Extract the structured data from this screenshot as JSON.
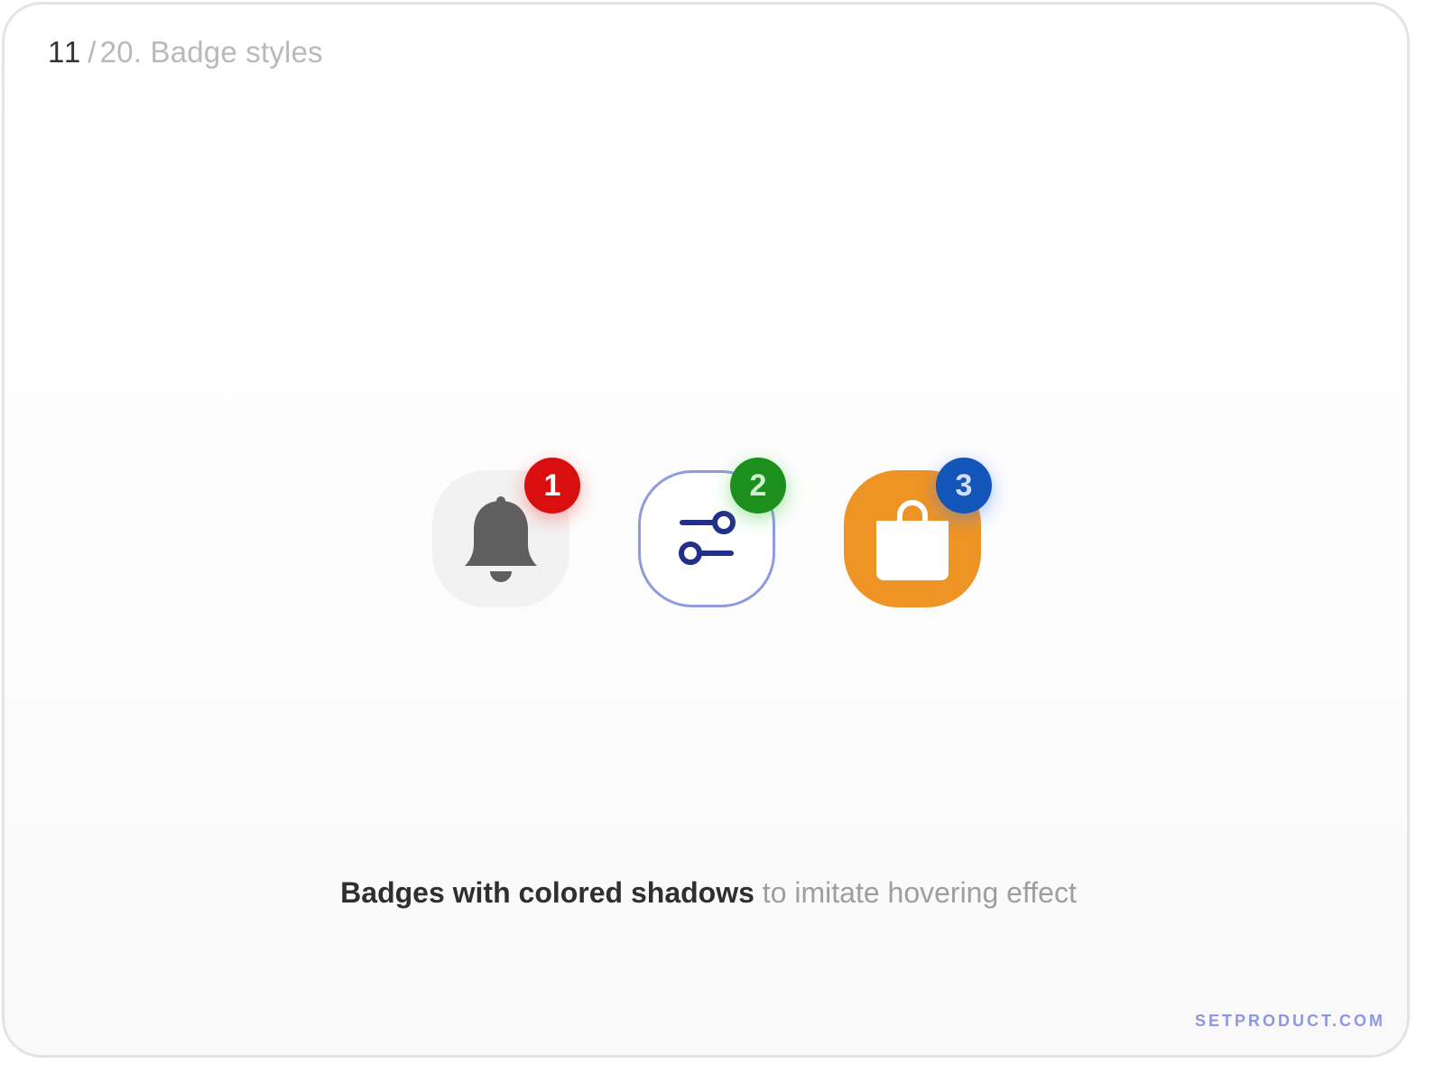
{
  "header": {
    "current": "11",
    "separator": "/",
    "total_and_title": "20. Badge styles"
  },
  "icons": [
    {
      "name": "bell-icon",
      "tile_style": "filled-light",
      "tile_color": "#f2f2f2",
      "glyph_color": "#5f5f5f"
    },
    {
      "name": "settings-sliders-icon",
      "tile_style": "outlined",
      "tile_color": "#ffffff",
      "border_color": "#8f9be0",
      "glyph_color": "#23308a"
    },
    {
      "name": "shopping-bag-icon",
      "tile_style": "filled-accent",
      "tile_color": "#ee9424",
      "glyph_color": "#ffffff"
    }
  ],
  "badges": [
    {
      "value": "1",
      "color": "#d90f0f",
      "text_color": "#ffffff"
    },
    {
      "value": "2",
      "color": "#1c8f1c",
      "text_color": "#cdf0cd"
    },
    {
      "value": "3",
      "color": "#1355b8",
      "text_color": "#cfe0ff"
    }
  ],
  "caption": {
    "strong": "Badges with colored shadows",
    "muted": " to imitate hovering effect"
  },
  "brand": {
    "label": "SETPRODUCT.COM",
    "color": "#8c97e0"
  }
}
